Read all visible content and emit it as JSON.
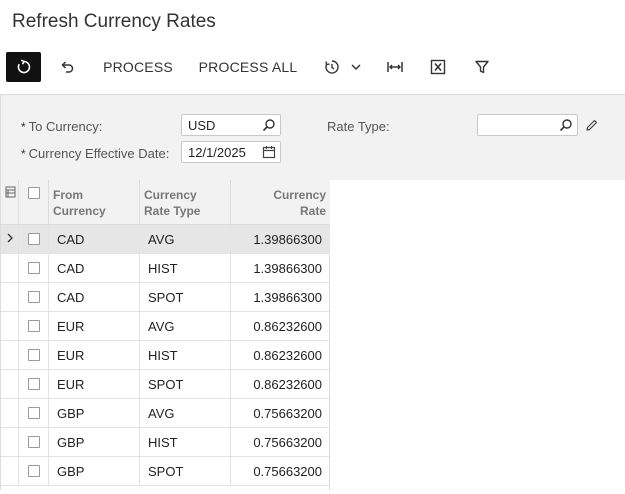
{
  "page": {
    "title": "Refresh Currency Rates"
  },
  "toolbar": {
    "refresh_icon": "refresh-icon",
    "undo_icon": "undo-icon",
    "process_label": "PROCESS",
    "process_all_label": "PROCESS ALL",
    "schedule_icon": "schedule-icon",
    "fit_icon": "fit-to-screen-icon",
    "excel_icon": "export-excel-icon",
    "filter_icon": "filter-icon"
  },
  "form": {
    "to_currency": {
      "label": "To Currency:",
      "value": "USD"
    },
    "effective_date": {
      "label": "Currency Effective Date:",
      "value": "12/1/2025"
    },
    "rate_type": {
      "label": "Rate Type:",
      "value": ""
    }
  },
  "grid": {
    "columns": {
      "from_line1": "From",
      "from_line2": "Currency",
      "type_line1": "Currency",
      "type_line2": "Rate Type",
      "rate_line1": "Currency",
      "rate_line2": "Rate"
    },
    "rows": [
      {
        "from": "CAD",
        "type": "AVG",
        "rate": "1.39866300"
      },
      {
        "from": "CAD",
        "type": "HIST",
        "rate": "1.39866300"
      },
      {
        "from": "CAD",
        "type": "SPOT",
        "rate": "1.39866300"
      },
      {
        "from": "EUR",
        "type": "AVG",
        "rate": "0.86232600"
      },
      {
        "from": "EUR",
        "type": "HIST",
        "rate": "0.86232600"
      },
      {
        "from": "EUR",
        "type": "SPOT",
        "rate": "0.86232600"
      },
      {
        "from": "GBP",
        "type": "AVG",
        "rate": "0.75663200"
      },
      {
        "from": "GBP",
        "type": "HIST",
        "rate": "0.75663200"
      },
      {
        "from": "GBP",
        "type": "SPOT",
        "rate": "0.75663200"
      }
    ]
  }
}
